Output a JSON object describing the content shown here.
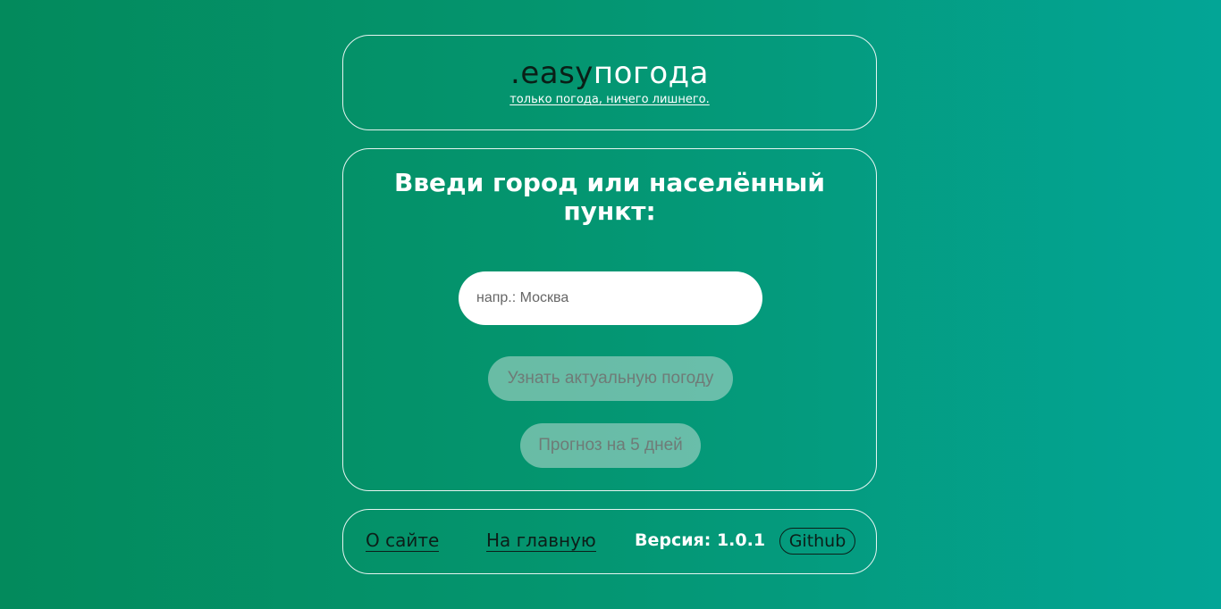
{
  "header": {
    "logo_prefix": ".easy",
    "logo_suffix": "погода",
    "tagline": "только погода, ничего лишнего."
  },
  "main": {
    "prompt": "Введи город или населённый пункт:",
    "input_placeholder": "напр.: Москва",
    "input_value": "",
    "current_weather_button": "Узнать актуальную погоду",
    "forecast_button": "Прогноз на 5 дней"
  },
  "footer": {
    "about_link": "О сайте",
    "home_link": "На главную",
    "version": "Версия: 1.0.1",
    "github_button": "Github"
  }
}
